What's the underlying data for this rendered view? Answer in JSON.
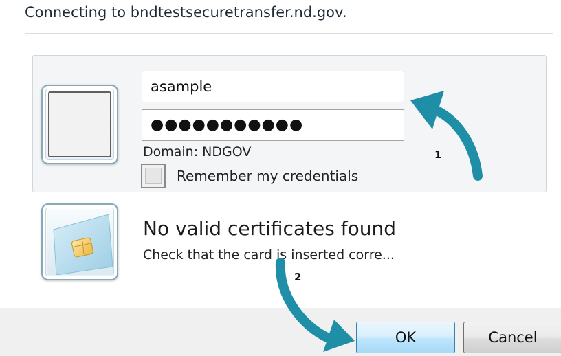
{
  "dialog": {
    "title": "Connecting to bndtestsecuretransfer.nd.gov."
  },
  "credentials": {
    "icon": "user-tile-icon",
    "username_value": "asample",
    "password_mask": "●●●●●●●●●●●",
    "domain_label": "Domain: NDGOV",
    "remember_label": "Remember my credentials",
    "remember_checked": false
  },
  "smartcard": {
    "icon": "smart-card-icon",
    "title": "No valid certificates found",
    "subtitle": "Check that the card is inserted corre..."
  },
  "buttons": {
    "ok_label": "OK",
    "cancel_label": "Cancel"
  },
  "annotations": {
    "callout_1": "1",
    "callout_2": "2",
    "arrow_color": "#1e8fa6"
  }
}
